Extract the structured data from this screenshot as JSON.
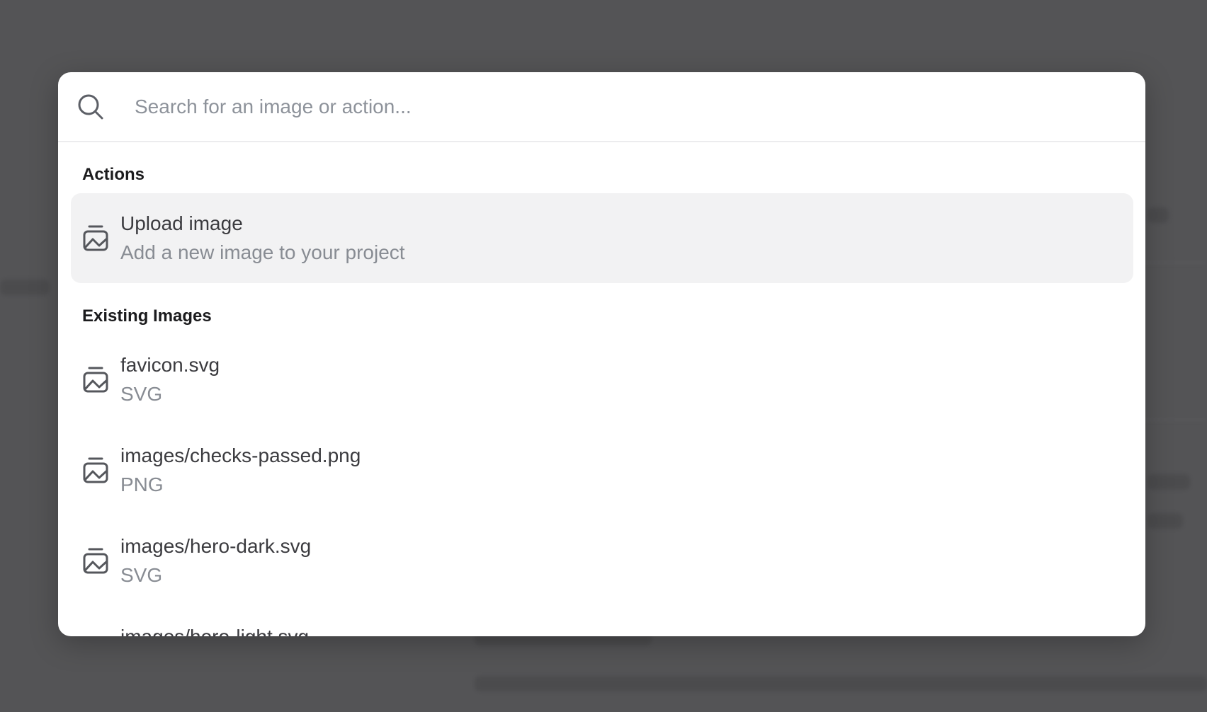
{
  "search": {
    "placeholder": "Search for an image or action...",
    "value": ""
  },
  "sections": {
    "actions": {
      "label": "Actions",
      "items": [
        {
          "title": "Upload image",
          "subtitle": "Add a new image to your project",
          "icon": "image-icon",
          "selected": true
        }
      ]
    },
    "existing": {
      "label": "Existing Images",
      "items": [
        {
          "title": "favicon.svg",
          "subtitle": "SVG",
          "icon": "image-icon"
        },
        {
          "title": "images/checks-passed.png",
          "subtitle": "PNG",
          "icon": "image-icon"
        },
        {
          "title": "images/hero-dark.svg",
          "subtitle": "SVG",
          "icon": "image-icon"
        },
        {
          "title": "images/hero-light.svg",
          "icon": "image-icon"
        }
      ]
    }
  },
  "colors": {
    "overlay": "#545456",
    "modal_bg": "#ffffff",
    "selected_bg": "#f2f2f3",
    "placeholder": "#8d929a",
    "subtitle": "#888c93"
  }
}
